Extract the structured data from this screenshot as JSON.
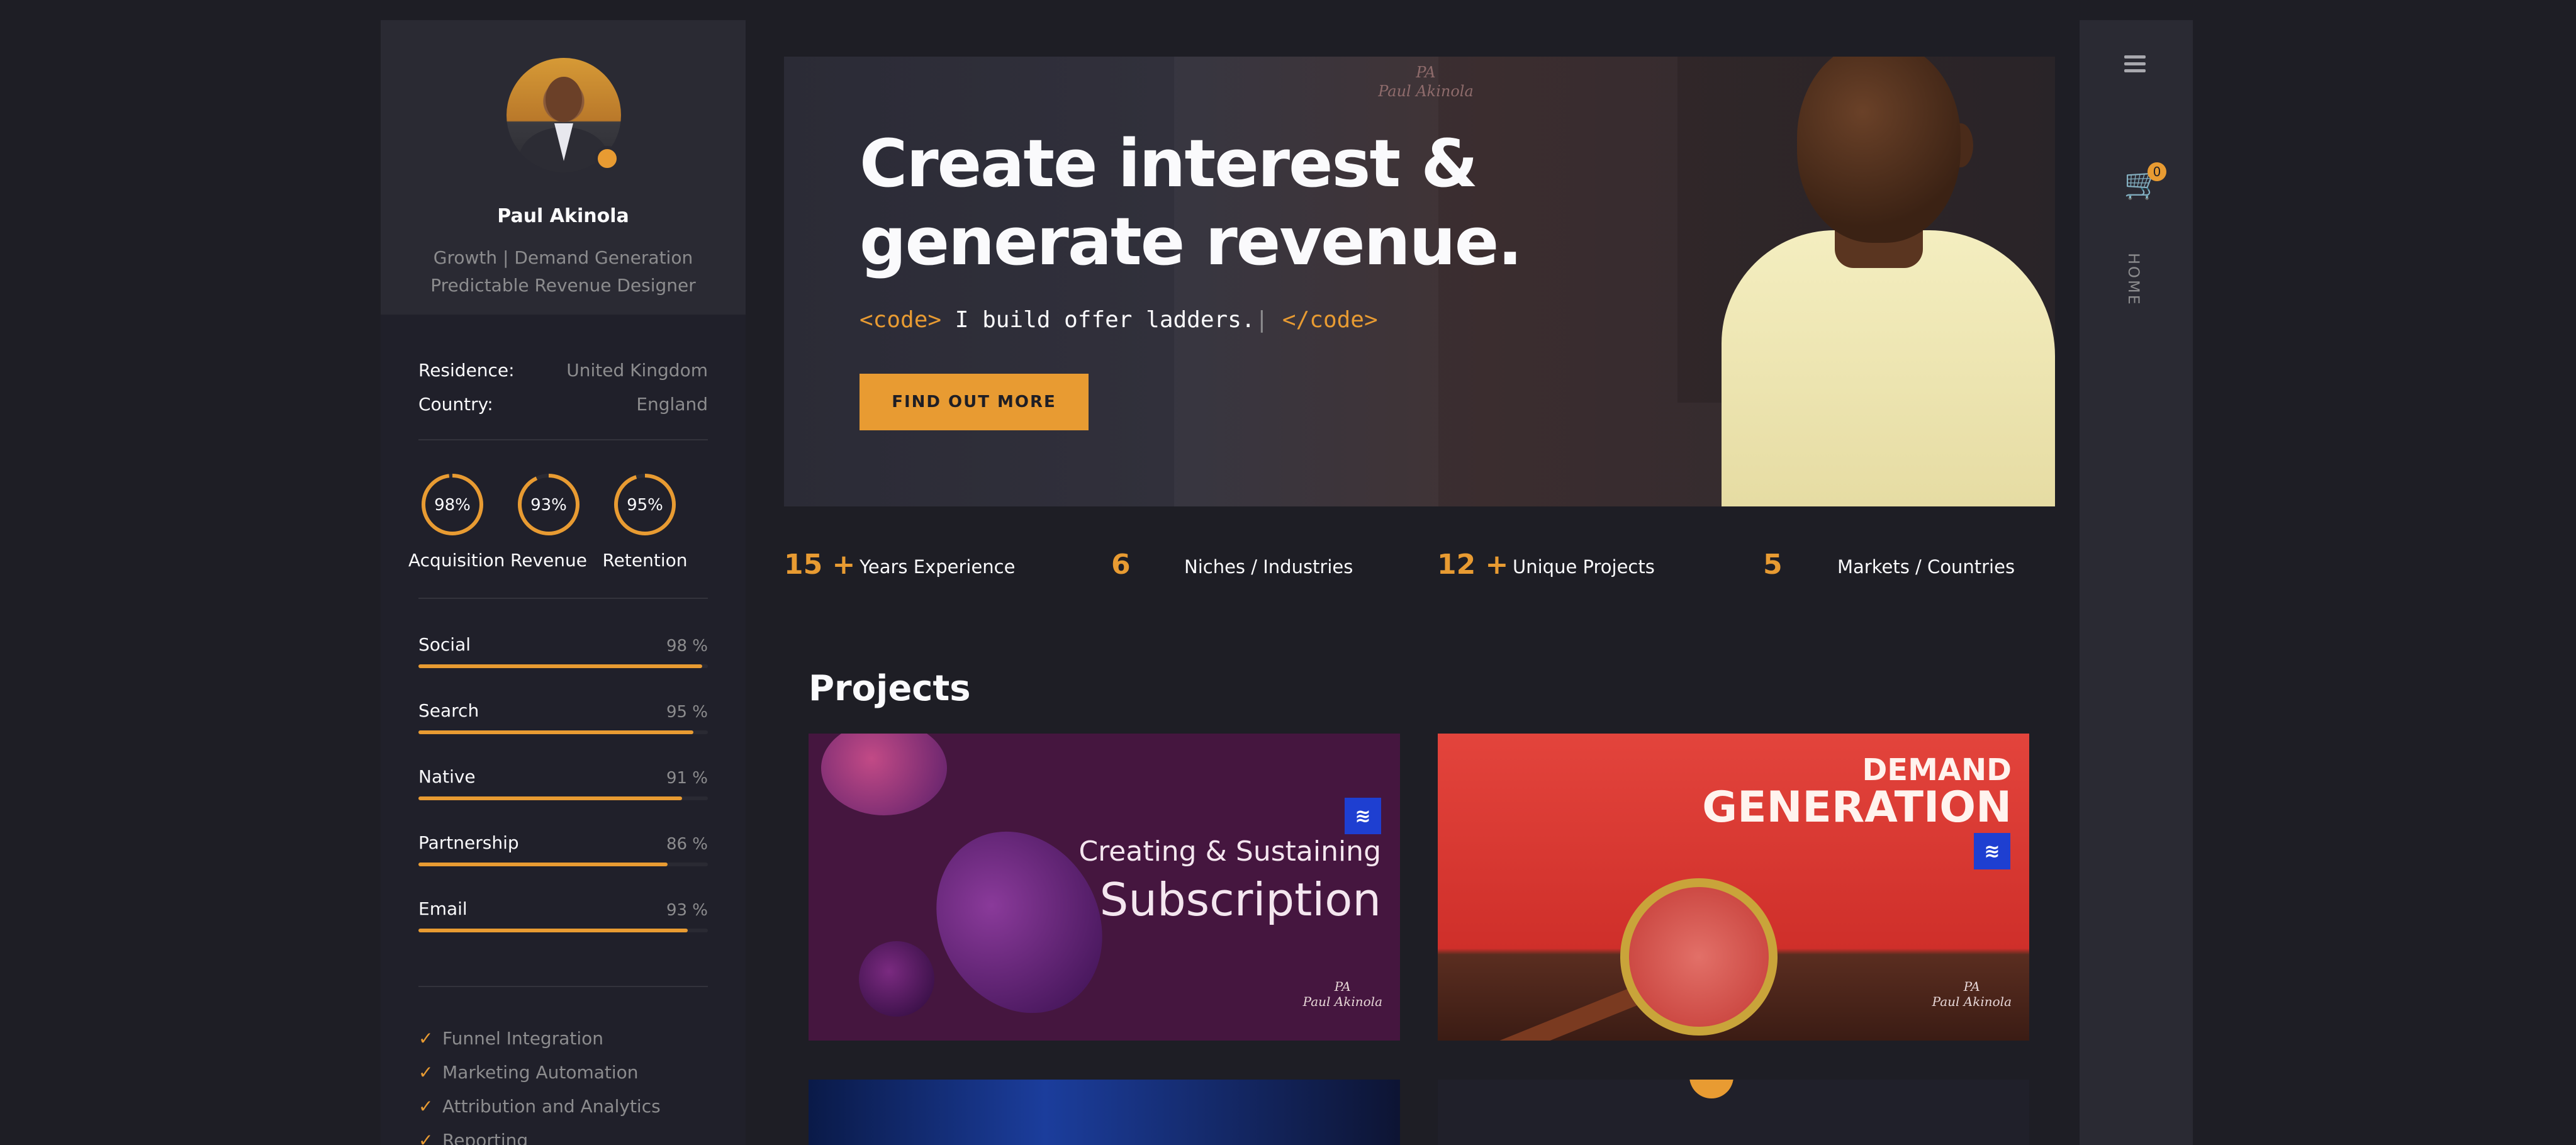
{
  "profile": {
    "name": "Paul Akinola",
    "role_line1": "Growth | Demand Generation",
    "role_line2": "Predictable Revenue Designer",
    "residence_label": "Residence:",
    "residence_value": "United Kingdom",
    "country_label": "Country:",
    "country_value": "England"
  },
  "circles": [
    {
      "label": "Acquisition",
      "value_text": "98%",
      "value": 0.98
    },
    {
      "label": "Revenue",
      "value_text": "93%",
      "value": 0.93
    },
    {
      "label": "Retention",
      "value_text": "95%",
      "value": 0.95
    }
  ],
  "skills": [
    {
      "label": "Social",
      "value_text": "98 %",
      "value": 0.98
    },
    {
      "label": "Search",
      "value_text": "95 %",
      "value": 0.95
    },
    {
      "label": "Native",
      "value_text": "91 %",
      "value": 0.91
    },
    {
      "label": "Partnership",
      "value_text": "86 %",
      "value": 0.86
    },
    {
      "label": "Email",
      "value_text": "93 %",
      "value": 0.93
    }
  ],
  "checklist": [
    "Funnel Integration",
    "Marketing Automation",
    "Attribution and Analytics",
    "Reporting"
  ],
  "hero": {
    "logo_mark": "PA",
    "logo_signature": "Paul Akinola",
    "headline_line1": "Create interest &",
    "headline_line2": "generate revenue.",
    "code_open": "<code>",
    "code_text": " I build offer ladders.",
    "code_caret": "|",
    "code_close": "</code>",
    "cta_label": "FIND OUT MORE"
  },
  "stats": [
    {
      "number": "15 +",
      "label": "Years Experience"
    },
    {
      "number": "6",
      "label": "Niches / Industries"
    },
    {
      "number": "12 +",
      "label": "Unique Projects"
    },
    {
      "number": "5",
      "label": "Markets / Countries"
    }
  ],
  "projects": {
    "title": "Projects",
    "card1_line1": "Creating & Sustaining",
    "card1_line2": "Subscription",
    "card2_line1": "DEMAND",
    "card2_line2": "GENERATION",
    "brand_icon": "≋",
    "signature_mark": "PA",
    "signature_name": "Paul Akinola"
  },
  "rail": {
    "cart_count": "0",
    "nav_label": "HOME",
    "menu_icon": "hamburger-icon",
    "cart_icon": "cart-icon"
  },
  "colors": {
    "accent": "#e89b32",
    "background": "#1e1e25",
    "panel": "#2a2a33"
  }
}
